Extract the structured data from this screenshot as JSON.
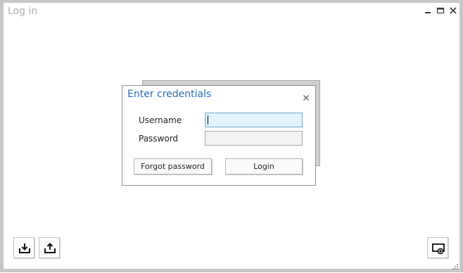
{
  "window": {
    "title": "Log in",
    "controls": {
      "minimize": "minimize-icon",
      "maximize": "maximize-icon",
      "close": "close-icon"
    }
  },
  "dialog": {
    "title": "Enter credentials",
    "close_icon": "close-icon",
    "username_label": "Username",
    "username_value": "",
    "password_label": "Password",
    "password_value": "",
    "forgot_button": "Forgot password",
    "login_button": "Login"
  },
  "toolbar": {
    "left": [
      {
        "icon": "import-icon"
      },
      {
        "icon": "export-icon"
      }
    ],
    "right": [
      {
        "icon": "screen-add-icon"
      }
    ]
  },
  "colors": {
    "title_text": "#b0b0b0",
    "dialog_title": "#2a6eb5",
    "focused_input_bg": "#e3f3fc",
    "frame": "#c7c7c7"
  }
}
